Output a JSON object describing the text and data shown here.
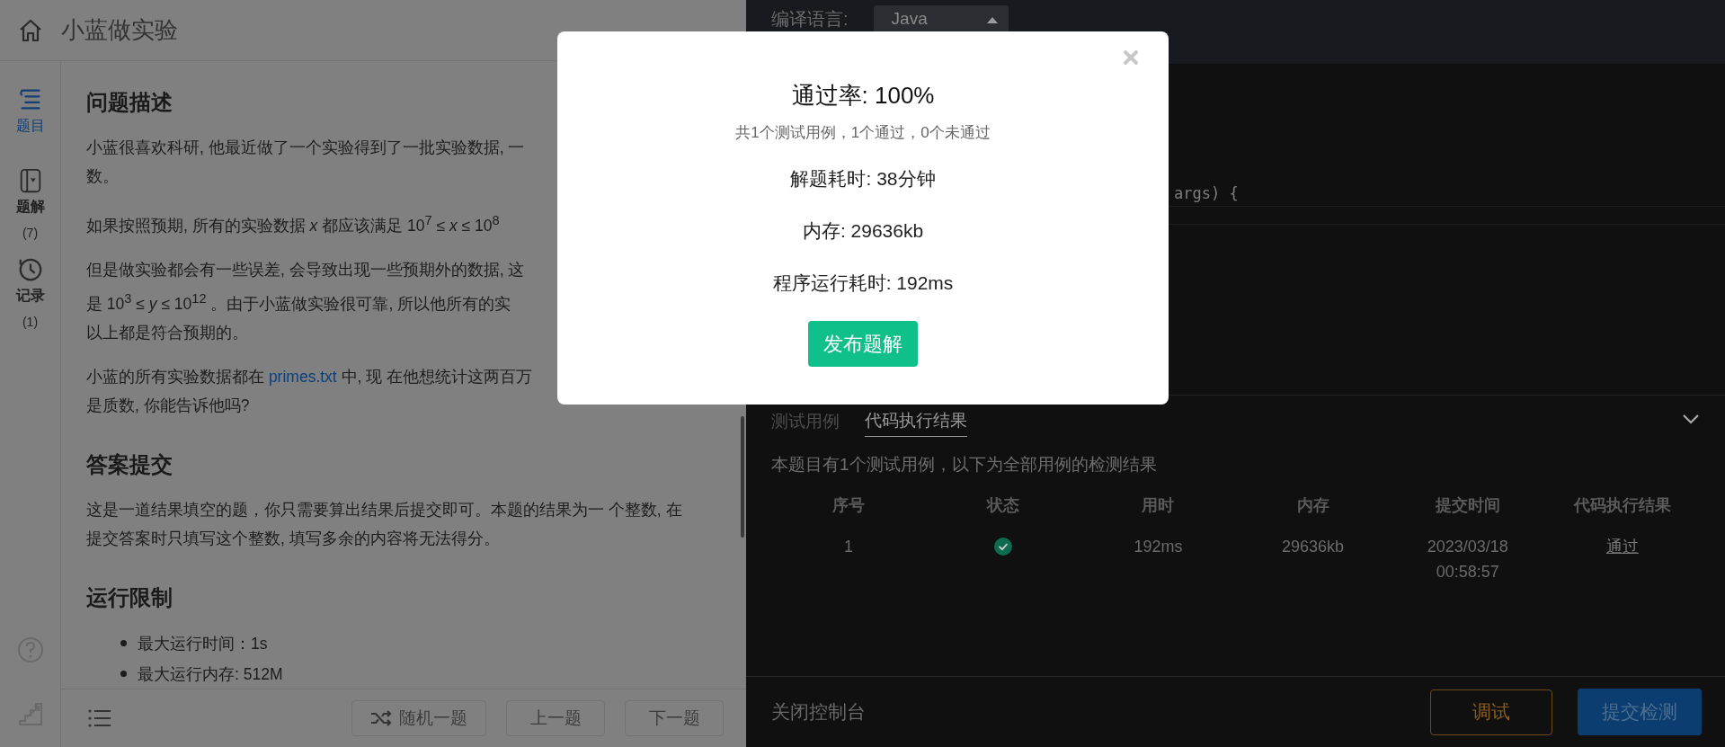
{
  "problem_panel": {
    "title": "小蓝做实验",
    "sidebar": [
      {
        "label": "题目",
        "selected": true
      },
      {
        "label": "题解",
        "count": "(7)",
        "selected": false
      },
      {
        "label": "记录",
        "count": "(1)",
        "selected": false
      }
    ],
    "sections": [
      {
        "heading": "问题描述",
        "paragraphs": [
          {
            "lines": [
              "小蓝很喜欢科研, 他最近做了一个实验得到了一批实验数据, 一",
              "数。"
            ]
          },
          {
            "lines": [
              "如果按照预期, 所有的实验数据 *x* 都应该满足 10$^{7}$ ≤ *x* ≤ 10$^{8}$"
            ]
          },
          {
            "lines": [
              "但是做实验都会有一些误差, 会导致出现一些预期外的数据, 这",
              "是 10$^{3}$ ≤ *y* ≤ 10$^{12}$ 。由于小蓝做实验很可靠, 所以他所有的实",
              "以上都是符合预期的。"
            ]
          },
          {
            "lines": [
              [
                {
                  "text": "小蓝的所有实验数据都在 "
                },
                {
                  "text": "primes.txt",
                  "kind": "link"
                },
                {
                  "text": " 中, 现 在他想统计这两百万"
                }
              ],
              "是质数, 你能告诉他吗?"
            ]
          }
        ]
      },
      {
        "heading": "答案提交",
        "paragraphs": [
          {
            "lines": [
              "这是一道结果填空的题，你只需要算出结果后提交即可。本题的结果为一 个整数, 在",
              "提交答案时只填写这个整数, 填写多余的内容将无法得分。"
            ]
          }
        ]
      },
      {
        "heading": "运行限制",
        "bullets": [
          "最大运行时间：1s",
          "最大运行内存: 512M"
        ]
      }
    ],
    "footer_buttons": [
      "随机一题",
      "上一题",
      "下一题"
    ]
  },
  "editor": {
    "language_label": "编译语言:",
    "language": "Java",
    "code_line": "args) {"
  },
  "console": {
    "tabs": [
      {
        "label": "测试用例",
        "selected": false
      },
      {
        "label": "代码执行结果",
        "selected": true
      }
    ],
    "description": "本题目有1个测试用例，以下为全部用例的检测结果",
    "columns": [
      "序号",
      "状态",
      "用时",
      "内存",
      "提交时间",
      "代码执行结果"
    ],
    "rows": [
      {
        "index": "1",
        "passed": true,
        "time": "192ms",
        "memory": "29636kb",
        "submitted": "2023/03/18 00:58:57",
        "result": "通过"
      }
    ],
    "close_label": "关闭控制台",
    "buttons": [
      {
        "label": "调试",
        "kind": "outline"
      },
      {
        "label": "提交检测",
        "kind": "primary"
      }
    ]
  },
  "modal": {
    "title": "通过率: 100%",
    "summary": "共1个测试用例，1个通过，0个未通过",
    "stats": [
      "解题耗时: 38分钟",
      "内存: 29636kb",
      "程序运行耗时: 192ms"
    ],
    "button": "发布题解"
  }
}
